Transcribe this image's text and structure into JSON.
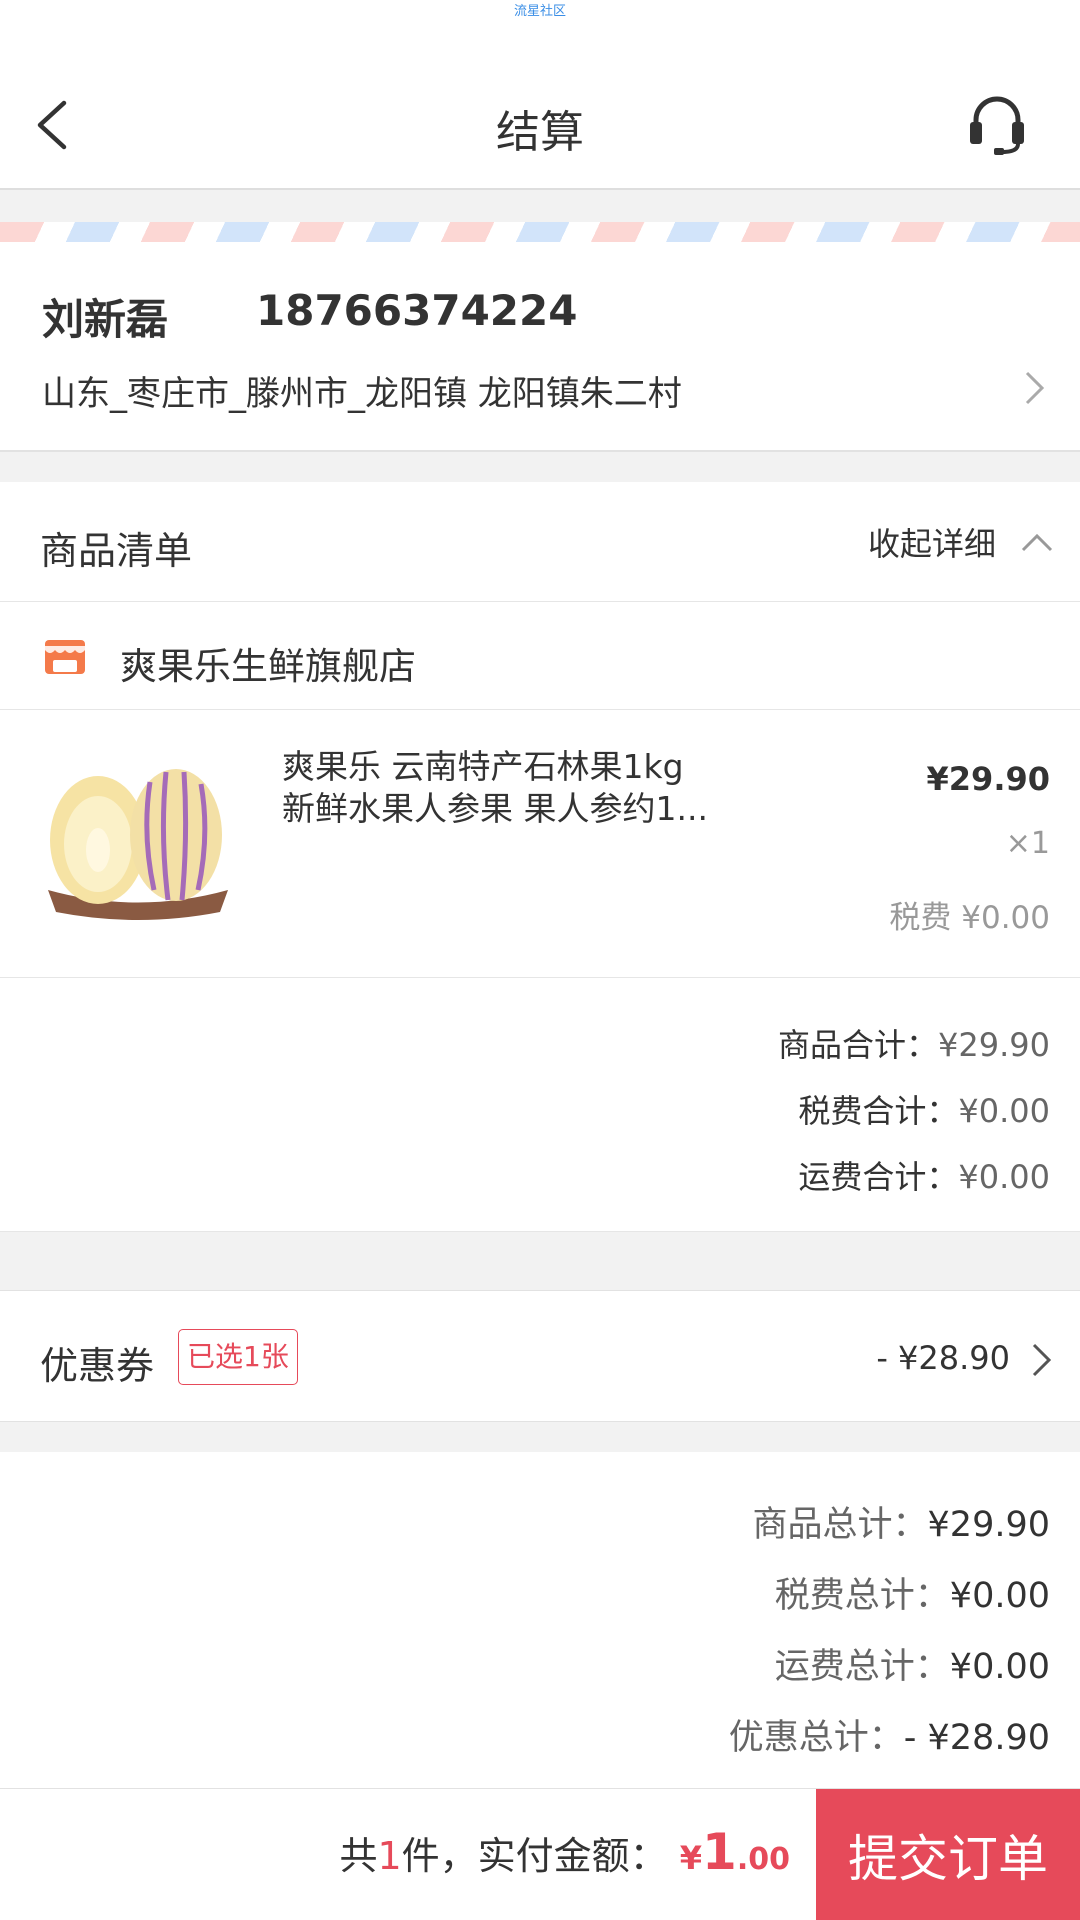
{
  "status_bar": {
    "text": "流星社区"
  },
  "header": {
    "title": "结算",
    "back_icon": "chevron-left-icon",
    "service_icon": "headset-icon"
  },
  "address": {
    "name": "刘新磊",
    "phone": "18766374224",
    "detail": "山东_枣庄市_滕州市_龙阳镇 龙阳镇朱二村"
  },
  "goods": {
    "title": "商品清单",
    "collapse_label": "收起详细",
    "store_name": "爽果乐生鲜旗舰店",
    "product": {
      "title_line1": "爽果乐 云南特产石林果1kg",
      "title_line2": "新鲜水果人参果 果人参约1...",
      "price": "¥29.90",
      "qty": "×1",
      "tax": "税费 ¥0.00"
    },
    "subtotals": [
      {
        "label": "商品合计：",
        "value": "¥29.90"
      },
      {
        "label": "税费合计：",
        "value": "¥0.00"
      },
      {
        "label": "运费合计：",
        "value": "¥0.00"
      }
    ]
  },
  "coupon": {
    "label": "优惠券",
    "badge": "已选1张",
    "amount": "- ¥28.90"
  },
  "totals": [
    {
      "label": "商品总计：",
      "value": "¥29.90"
    },
    {
      "label": "税费总计：",
      "value": "¥0.00"
    },
    {
      "label": "运费总计：",
      "value": "¥0.00"
    },
    {
      "label": "优惠总计：",
      "value": "- ¥28.90"
    }
  ],
  "footer": {
    "prefix": "共",
    "count": "1",
    "suffix": "件，实付金额：",
    "currency": "¥",
    "amount_int": "1",
    "amount_dec": ".00",
    "submit_label": "提交订单"
  },
  "colors": {
    "accent": "#e64a5a",
    "store_icon": "#f47a4a",
    "status_text": "#3a8ee6"
  }
}
